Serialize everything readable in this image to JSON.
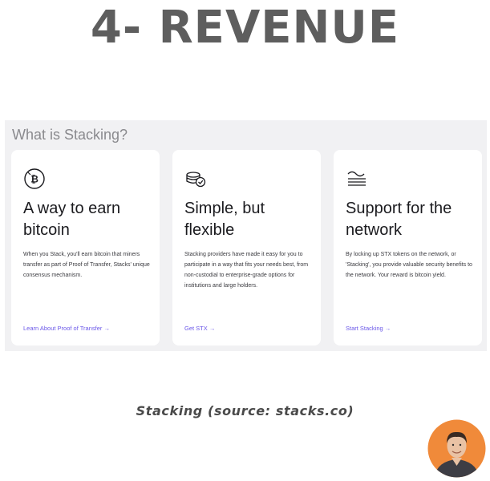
{
  "headline": "4- REVENUE",
  "panel": {
    "title": "What is Stacking?",
    "cards": [
      {
        "icon": "bitcoin-coin-icon",
        "heading_line1": "A way to earn",
        "heading_line2": "bitcoin",
        "body": "When you Stack, you'll earn bitcoin that miners transfer as part of Proof of Transfer, Stacks' unique consensus mechanism.",
        "link": "Learn About Proof of Transfer →"
      },
      {
        "icon": "stacked-coins-check-icon",
        "heading_line1": "Simple, but",
        "heading_line2": "flexible",
        "body": "Stacking providers have made it easy for you to participate in a way that fits your needs best, from non-custodial to enterprise-grade options for institutions and large holders.",
        "link": "Get STX →"
      },
      {
        "icon": "network-wave-icon",
        "heading_line1": "Support for the",
        "heading_line2": "network",
        "body": "By locking up STX tokens on the network, or 'Stacking', you provide valuable security benefits to the network. Your reward is bitcoin yield.",
        "link": "Start Stacking →"
      }
    ]
  },
  "caption": "Stacking (source: stacks.co)",
  "colors": {
    "headline": "#5e5e5e",
    "panel_bg": "#f1f1f3",
    "link": "#6a57e8",
    "avatar_bg": "#f08a3a"
  }
}
